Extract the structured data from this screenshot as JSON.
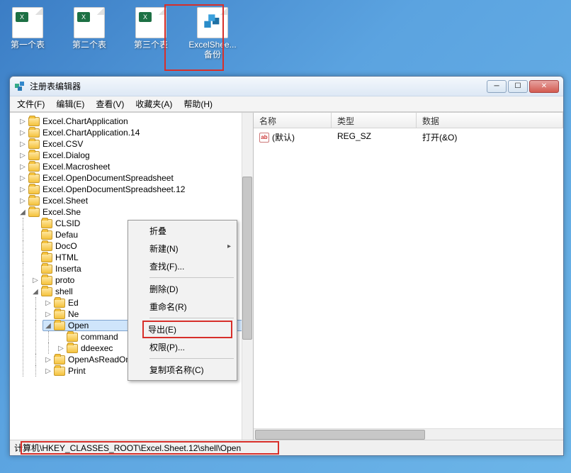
{
  "desktop": {
    "icons": [
      {
        "label": "第一个表",
        "type": "xls"
      },
      {
        "label": "第二个表",
        "type": "xls"
      },
      {
        "label": "第三个表",
        "type": "xls"
      },
      {
        "label": "ExcelShee...\n备份",
        "type": "reg"
      }
    ]
  },
  "window": {
    "title": "注册表编辑器",
    "menu": [
      "文件(F)",
      "编辑(E)",
      "查看(V)",
      "收藏夹(A)",
      "帮助(H)"
    ],
    "tree": {
      "items": [
        "Excel.ChartApplication",
        "Excel.ChartApplication.14",
        "Excel.CSV",
        "Excel.Dialog",
        "Excel.Macrosheet",
        "Excel.OpenDocumentSpreadsheet",
        "Excel.OpenDocumentSpreadsheet.12",
        "Excel.Sheet"
      ],
      "expanded_label": "Excel.She",
      "expanded_children": [
        "CLSID",
        "Defau",
        "DocO",
        "HTML",
        "Inserta",
        "proto"
      ],
      "shell_label": "shell",
      "shell_children": [
        "Ed",
        "Ne"
      ],
      "selected": "Open",
      "open_children": [
        "command",
        "ddeexec"
      ],
      "after_open": [
        "OpenAsReadOnly",
        "Print"
      ]
    },
    "list": {
      "headers": {
        "name": "名称",
        "type": "类型",
        "data": "数据"
      },
      "rows": [
        {
          "name": "(默认)",
          "type": "REG_SZ",
          "data": "打开(&O)"
        }
      ]
    },
    "statusbar": "计算机\\HKEY_CLASSES_ROOT\\Excel.Sheet.12\\shell\\Open"
  },
  "context_menu": {
    "items": [
      {
        "label": "折叠"
      },
      {
        "label": "新建(N)",
        "submenu": true
      },
      {
        "label": "查找(F)..."
      },
      {
        "sep": true
      },
      {
        "label": "删除(D)"
      },
      {
        "label": "重命名(R)"
      },
      {
        "sep": true
      },
      {
        "label": "导出(E)",
        "highlight": true
      },
      {
        "label": "权限(P)..."
      },
      {
        "sep": true
      },
      {
        "label": "复制项名称(C)"
      }
    ]
  }
}
